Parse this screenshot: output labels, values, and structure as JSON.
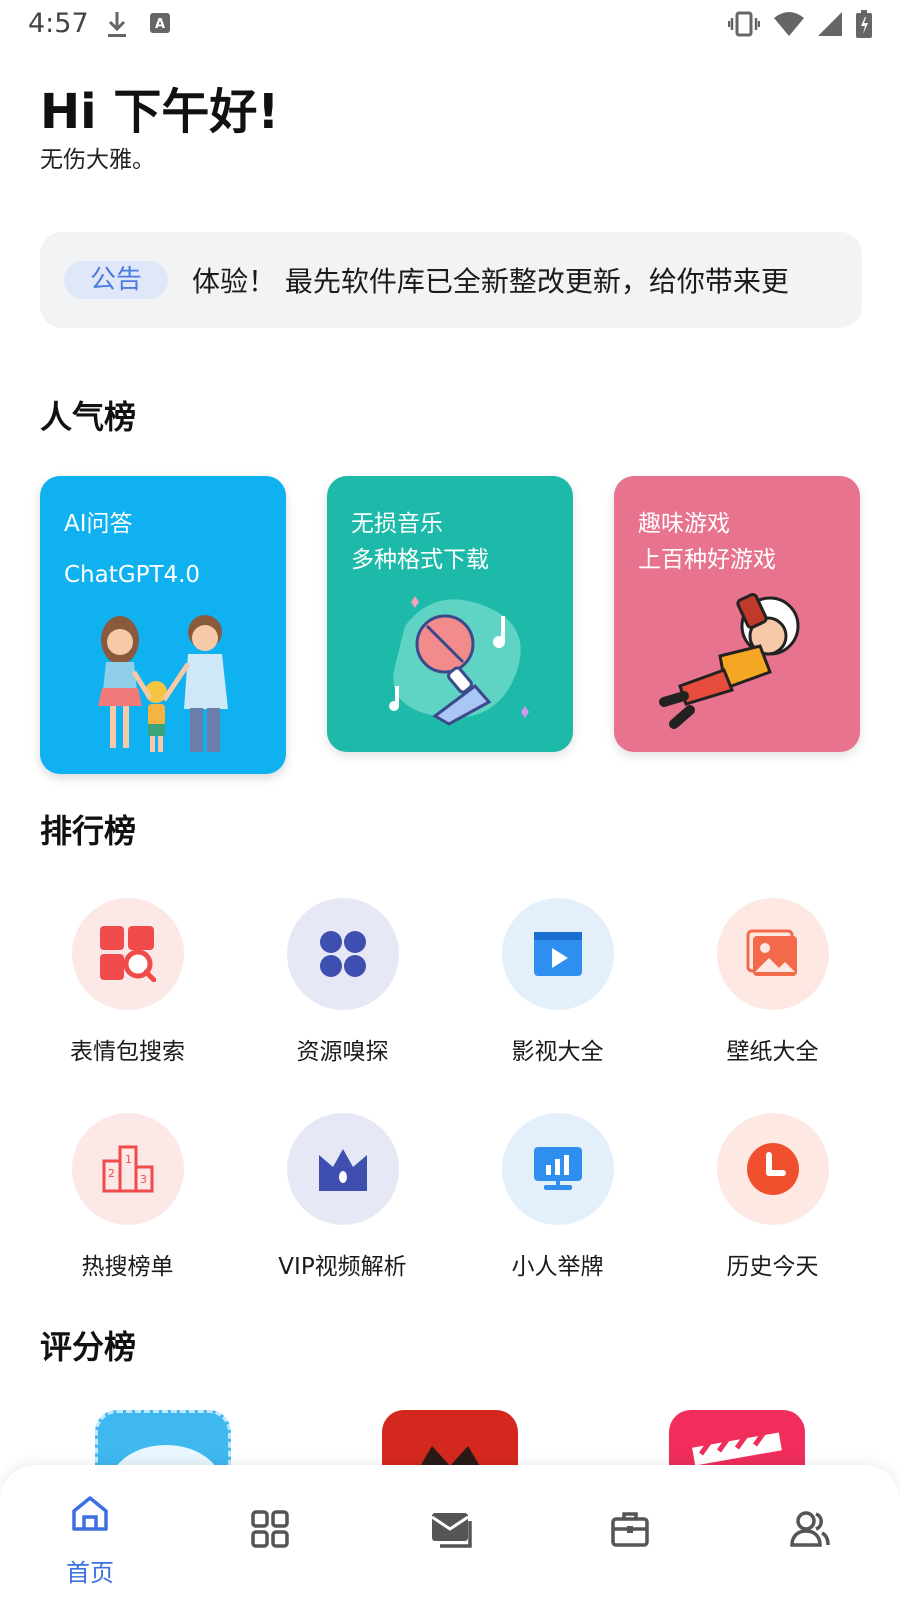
{
  "status_bar": {
    "time": "4:57"
  },
  "greeting": {
    "title": "Hi 下午好!",
    "subtitle": "无伤大雅。"
  },
  "notice": {
    "tag": "公告",
    "text": "体验！    最先软件库已全新整改更新，给你带来更"
  },
  "sections": {
    "popular": "人气榜",
    "ranking": "排行榜",
    "score": "评分榜"
  },
  "popular_cards": [
    {
      "line1": "AI问答",
      "line2": "ChatGPT4.0",
      "color": "#0fb1f0"
    },
    {
      "line1": "无损音乐",
      "line2": "多种格式下载",
      "color": "#1ebaa9"
    },
    {
      "line1": "趣味游戏",
      "line2": "上百种好游戏",
      "color": "#e8738f"
    }
  ],
  "tools": [
    {
      "label": "表情包搜索",
      "icon": "emoji-search-icon"
    },
    {
      "label": "资源嗅探",
      "icon": "apps-grid-icon"
    },
    {
      "label": "影视大全",
      "icon": "video-play-icon"
    },
    {
      "label": "壁纸大全",
      "icon": "wallpaper-image-icon"
    },
    {
      "label": "热搜榜单",
      "icon": "podium-icon"
    },
    {
      "label": "VIP视频解析",
      "icon": "crown-icon"
    },
    {
      "label": "小人举牌",
      "icon": "chart-board-icon"
    },
    {
      "label": "历史今天",
      "icon": "clock-icon"
    }
  ],
  "bottom_nav": [
    {
      "label": "首页",
      "icon": "home-icon",
      "active": true
    },
    {
      "label": "",
      "icon": "category-grid-icon"
    },
    {
      "label": "",
      "icon": "mail-icon"
    },
    {
      "label": "",
      "icon": "toolbox-icon"
    },
    {
      "label": "",
      "icon": "users-icon"
    }
  ],
  "colors": {
    "accent": "#3d6fe0",
    "notice_bg": "#f2f3f5"
  }
}
